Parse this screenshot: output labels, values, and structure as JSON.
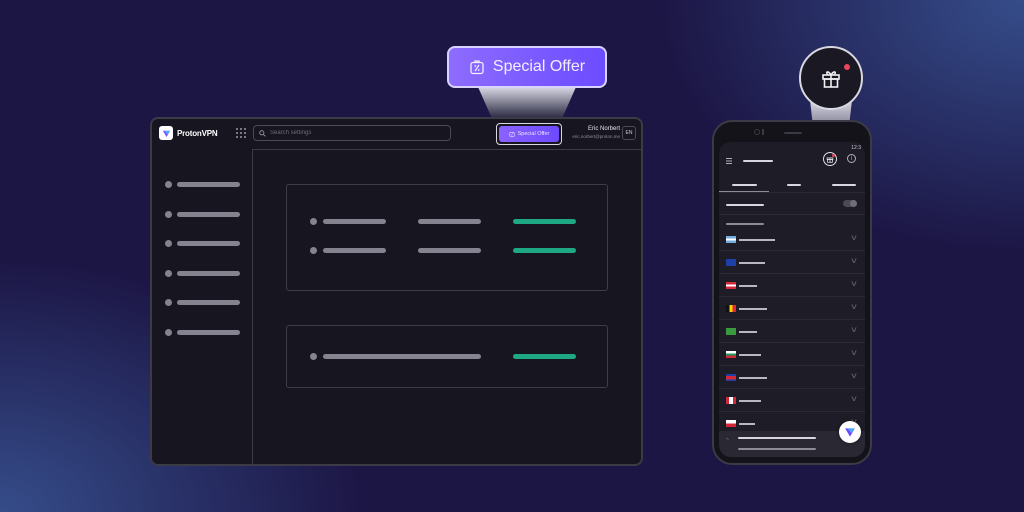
{
  "desktop": {
    "app_name": "ProtonVPN",
    "search_placeholder": "Search settings",
    "special_offer_label": "Special Offer",
    "user_name": "Eric Norbert",
    "user_email": "eric.norbert@proton.me",
    "language": "EN",
    "sidebar_items": 6,
    "card1_rows": [
      {
        "status": "active"
      },
      {
        "status": "active"
      }
    ],
    "card2_rows": [
      {
        "status": "active"
      }
    ]
  },
  "callouts": {
    "special_offer_label": "Special Offer",
    "gift_notification": true
  },
  "phone": {
    "time": "12:3",
    "countries": [
      {
        "flag": "argentina"
      },
      {
        "flag": "australia"
      },
      {
        "flag": "austria"
      },
      {
        "flag": "belgium"
      },
      {
        "flag": "brazil"
      },
      {
        "flag": "bulgaria"
      },
      {
        "flag": "cambodia"
      },
      {
        "flag": "canada"
      },
      {
        "flag": "chile"
      }
    ]
  },
  "colors": {
    "accent": "#6d4aff",
    "success": "#1ea884",
    "notification": "#e9455d",
    "background": "#1c1645"
  },
  "icons": {
    "offer": "percent-tag-icon",
    "gift": "gift-icon",
    "search": "search-icon",
    "apps": "apps-grid-icon",
    "info": "info-icon",
    "menu": "hamburger-icon"
  }
}
